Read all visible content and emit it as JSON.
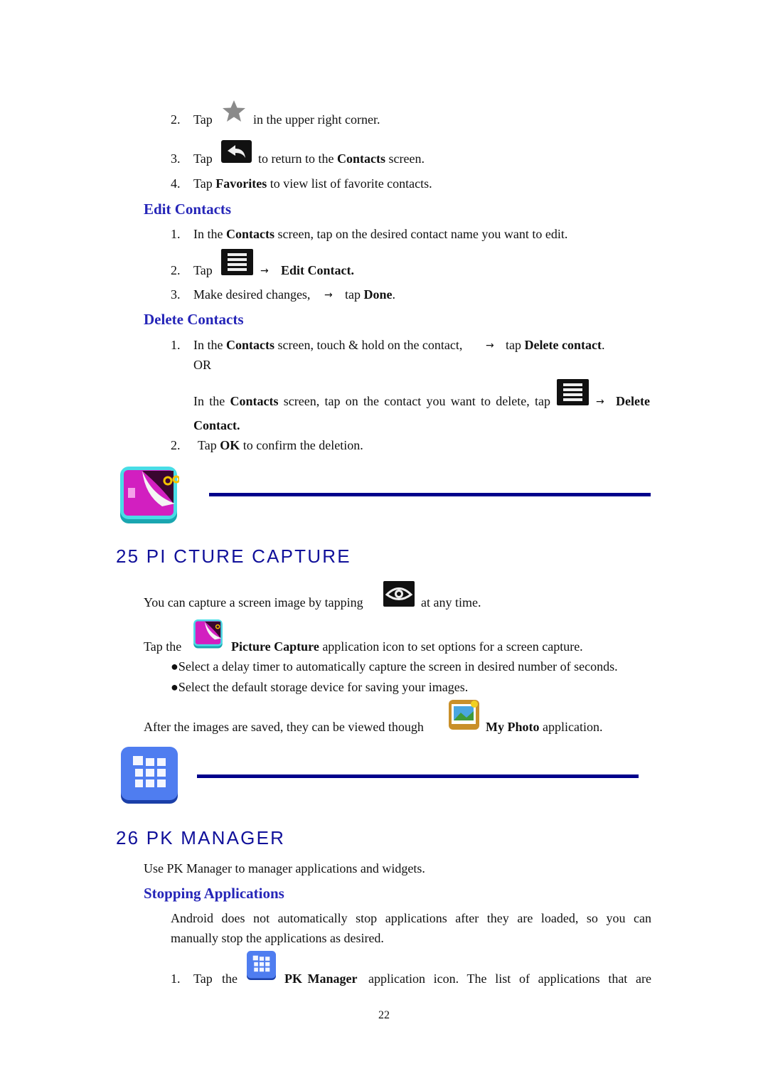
{
  "steps_favorites": [
    {
      "num": "2.",
      "pre": "Tap",
      "post": "in the upper right corner.",
      "icon": "star-icon"
    },
    {
      "num": "3.",
      "pre": "Tap",
      "post": "to return to the ",
      "bold": "Contacts",
      "post2": " screen.",
      "icon": "back-arrow-icon"
    },
    {
      "num": "4.",
      "pre": "Tap ",
      "bold": "Favorites",
      "post": " to view list of favorite contacts."
    }
  ],
  "edit_contacts": {
    "heading": "Edit Contacts",
    "s1": {
      "num": "1.",
      "a": "In the ",
      "b": "Contacts",
      "c": " screen, tap on the desired contact name you want to edit."
    },
    "s2": {
      "num": "2.",
      "a": "Tap",
      "arrow": "→",
      "b": "Edit Contact.",
      "icon": "menu-icon"
    },
    "s3": {
      "num": "3.",
      "a": "Make desired changes,",
      "arrow": "→",
      "c": "tap ",
      "b": "Done",
      "d": "."
    }
  },
  "delete_contacts": {
    "heading": "Delete Contacts",
    "s1": {
      "num": "1.",
      "a": "In the ",
      "b": "Contacts",
      "c": " screen, touch & hold on the contact,",
      "arrow": "→",
      "d": "tap ",
      "e": "Delete contact",
      "f": "."
    },
    "or": "OR",
    "alt": {
      "a": "In the ",
      "b": "Contacts",
      "c": " screen, tap on the contact you want to delete, tap",
      "arrow": "→",
      "d": "Delete",
      "e": "Contact."
    },
    "s2": {
      "num": "2.",
      "a": "Tap ",
      "b": "OK",
      "c": " to confirm the deletion."
    }
  },
  "picture_capture": {
    "heading": "25 PI CTURE CAPTURE",
    "p1": {
      "a": "You can capture a screen image by tapping",
      "b": "at any time."
    },
    "p2": {
      "a": "Tap the",
      "b": "Picture Capture",
      "c": " application icon to set options for a screen capture."
    },
    "bullets": [
      "●Select a delay timer to automatically capture the screen in desired number of seconds.",
      "●Select the default storage device for saving your images."
    ],
    "p3": {
      "a": "After the images are saved, they can be viewed though",
      "b": "My Photo",
      "c": " application."
    }
  },
  "pk_manager": {
    "heading": "26 PK MANAGER",
    "intro": "Use PK Manager to manager applications and widgets.",
    "subheading": "Stopping Applications",
    "para1": "Android does not automatically stop applications after they are loaded, so you can",
    "para2": "manually stop the applications as desired.",
    "s1": {
      "num": "1.",
      "a": "Tap the",
      "b": "PK Manager",
      "c": "application icon. The list of applications that are"
    }
  },
  "page_number": "22",
  "colors": {
    "heading": "#2525b8",
    "section_title": "#10109a",
    "rule": "#00008b"
  }
}
